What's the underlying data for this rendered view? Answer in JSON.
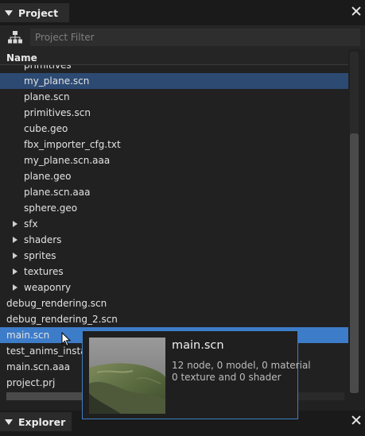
{
  "project_tab": {
    "title": "Project"
  },
  "filter": {
    "placeholder": "Project Filter"
  },
  "list_header": {
    "name": "Name"
  },
  "rows": [
    {
      "label": "primitives",
      "indent": 2,
      "arrow": false,
      "state": ""
    },
    {
      "label": "my_plane.scn",
      "indent": 2,
      "arrow": false,
      "state": "sel-dim"
    },
    {
      "label": "plane.scn",
      "indent": 2,
      "arrow": false,
      "state": ""
    },
    {
      "label": "primitives.scn",
      "indent": 2,
      "arrow": false,
      "state": ""
    },
    {
      "label": "cube.geo",
      "indent": 2,
      "arrow": false,
      "state": ""
    },
    {
      "label": "fbx_importer_cfg.txt",
      "indent": 2,
      "arrow": false,
      "state": ""
    },
    {
      "label": "my_plane.scn.aaa",
      "indent": 2,
      "arrow": false,
      "state": ""
    },
    {
      "label": "plane.geo",
      "indent": 2,
      "arrow": false,
      "state": ""
    },
    {
      "label": "plane.scn.aaa",
      "indent": 2,
      "arrow": false,
      "state": ""
    },
    {
      "label": "sphere.geo",
      "indent": 2,
      "arrow": false,
      "state": ""
    },
    {
      "label": "sfx",
      "indent": 1,
      "arrow": true,
      "state": ""
    },
    {
      "label": "shaders",
      "indent": 1,
      "arrow": true,
      "state": ""
    },
    {
      "label": "sprites",
      "indent": 1,
      "arrow": true,
      "state": ""
    },
    {
      "label": "textures",
      "indent": 1,
      "arrow": true,
      "state": ""
    },
    {
      "label": "weaponry",
      "indent": 1,
      "arrow": true,
      "state": ""
    },
    {
      "label": "debug_rendering.scn",
      "indent": 0,
      "arrow": false,
      "state": ""
    },
    {
      "label": "debug_rendering_2.scn",
      "indent": 0,
      "arrow": false,
      "state": ""
    },
    {
      "label": "main.scn",
      "indent": 0,
      "arrow": false,
      "state": "sel"
    },
    {
      "label": "test_anims_instan",
      "indent": 0,
      "arrow": false,
      "state": ""
    },
    {
      "label": "main.scn.aaa",
      "indent": 0,
      "arrow": false,
      "state": ""
    },
    {
      "label": "project.prj",
      "indent": 0,
      "arrow": false,
      "state": ""
    }
  ],
  "tooltip": {
    "title": "main.scn",
    "line1": "12 node, 0 model, 0 material",
    "line2": "0 texture and 0 shader"
  },
  "explorer_tab": {
    "title": "Explorer"
  },
  "colors": {
    "selection": "#3d7cc9",
    "selection_dim": "#2c4a72",
    "tooltip_border": "#3f7fc4"
  }
}
